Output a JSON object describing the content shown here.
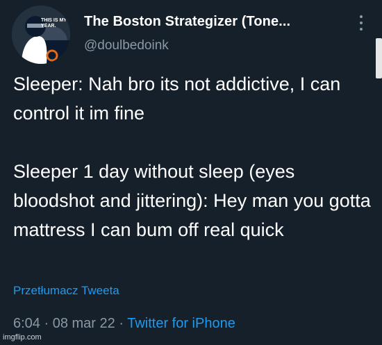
{
  "author": {
    "display_name": "The Boston Strategizer (Tone...",
    "handle": "@doulbedoink",
    "avatar_caption": "THIS IS MY YEAR."
  },
  "tweet": {
    "text": "Sleeper: Nah bro its not addictive, I can control it im fine\n\nSleeper 1 day without sleep (eyes bloodshot and jittering): Hey man you gotta mattress I can bum off real quick",
    "translate_label": "Przetłumacz Tweeta",
    "time": "6:04",
    "separator": " · ",
    "date": "08 mar 22",
    "source": "Twitter for iPhone"
  },
  "watermark": "imgflip.com",
  "colors": {
    "background": "#15202b",
    "text": "#ffffff",
    "secondary": "#8b98a5",
    "accent": "#1d9bf0"
  },
  "icons": {
    "more": "more-vertical-icon"
  }
}
